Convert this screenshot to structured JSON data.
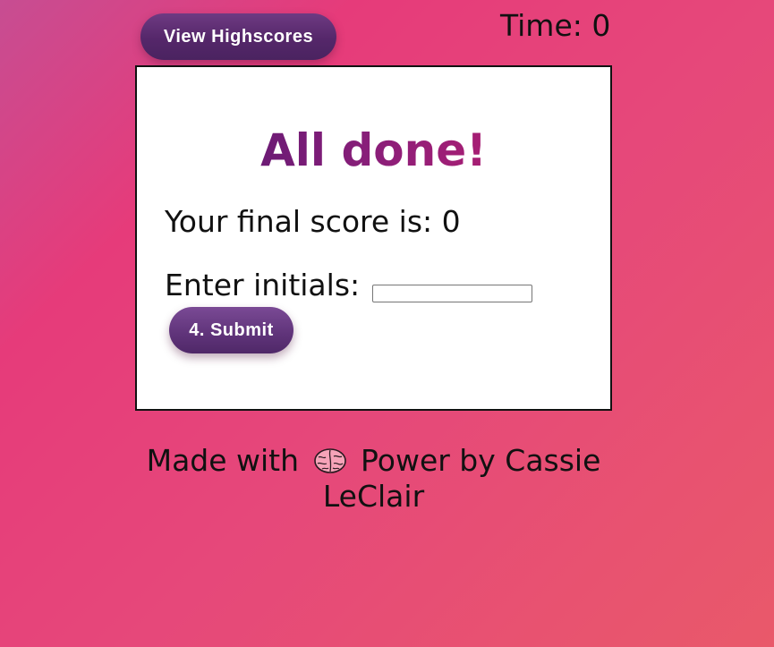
{
  "header": {
    "highscores_label": "View Highscores",
    "timer_text": "Time: 0"
  },
  "card": {
    "title": "All done!",
    "final_score_text": "Your final score is: 0",
    "initials_label": "Enter initials:",
    "initials_value": "",
    "initials_placeholder": "",
    "submit_label": "4. Submit"
  },
  "footer": {
    "prefix": "Made with",
    "icon": "brain-icon",
    "suffix": "Power by Cassie LeClair"
  },
  "colors": {
    "button_purple": "#55276a",
    "title_gradient_start": "#4c1770",
    "title_gradient_end": "#c81f6e",
    "background_pink": "#e63b7a"
  }
}
